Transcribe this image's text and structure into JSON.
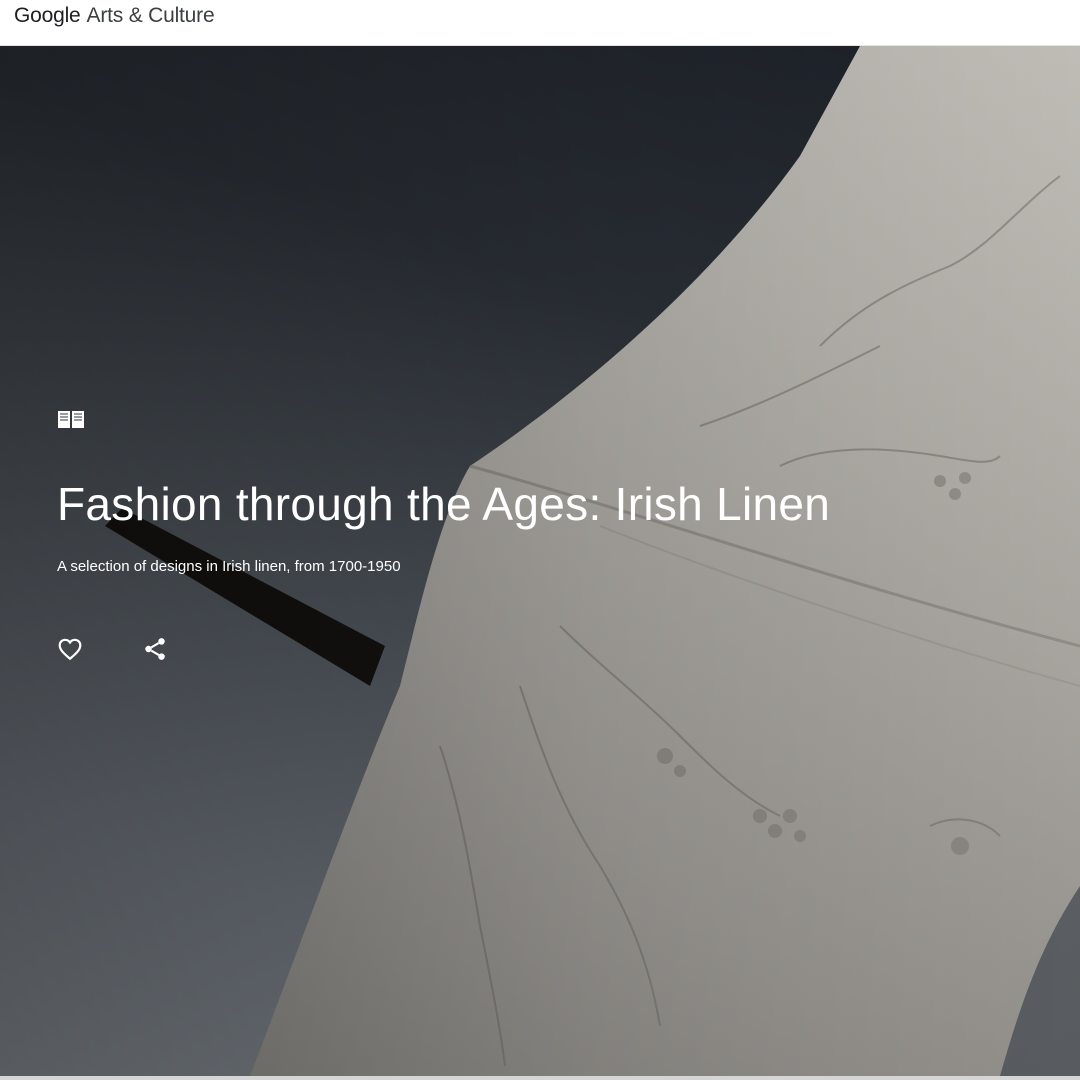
{
  "header": {
    "logo_brand": "Google",
    "logo_product": "Arts & Culture"
  },
  "hero": {
    "type_icon": "story-book-icon",
    "title": "Fashion through the Ages: Irish Linen",
    "subtitle": "A selection of designs in Irish linen, from 1700-1950",
    "actions": [
      {
        "icon": "heart-outline-icon"
      },
      {
        "icon": "share-icon"
      }
    ]
  },
  "colors": {
    "text_on_image": "#ffffff",
    "header_background": "#ffffff",
    "logo_text": "#3c4043"
  }
}
